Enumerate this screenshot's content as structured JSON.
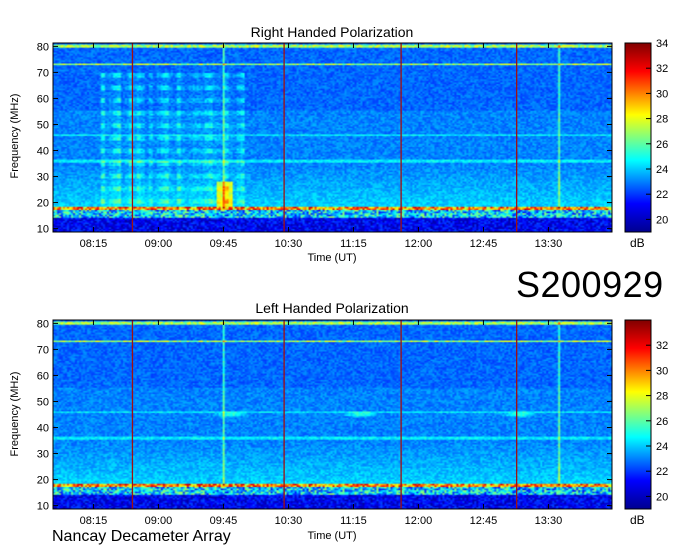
{
  "observation_id": "S200929",
  "instrument": "Nancay Decameter Array",
  "chart_data": [
    {
      "type": "heatmap",
      "title": "Right Handed Polarization",
      "xlabel": "Time (UT)",
      "ylabel": "Frequency (MHz)",
      "x_ticks": [
        "08:15",
        "09:00",
        "09:45",
        "10:30",
        "11:15",
        "12:00",
        "12:45",
        "13:30"
      ],
      "y_ticks": [
        10,
        20,
        30,
        40,
        50,
        60,
        70,
        80
      ],
      "ylim": [
        10,
        80
      ],
      "colorbar": {
        "label": "dB",
        "ticks": [
          20,
          22,
          24,
          26,
          28,
          30,
          32,
          34
        ],
        "range": [
          19,
          34
        ]
      },
      "features": {
        "baseline_db": 22.5,
        "strong_lines_mhz": [
          73,
          80
        ],
        "weak_lines_mhz": [
          36,
          46
        ],
        "low_band_mhz": [
          14,
          18.5
        ],
        "vertical_lines_time": [
          "08:42",
          "10:27",
          "11:48",
          "13:08"
        ],
        "bright_vertical_time": [
          "09:45",
          "13:37"
        ],
        "burst_interval": [
          "08:20",
          "10:00"
        ]
      }
    },
    {
      "type": "heatmap",
      "title": "Left Handed Polarization",
      "xlabel": "Time (UT)",
      "ylabel": "Frequency (MHz)",
      "x_ticks": [
        "08:15",
        "09:00",
        "09:45",
        "10:30",
        "11:15",
        "12:00",
        "12:45",
        "13:30"
      ],
      "y_ticks": [
        10,
        20,
        30,
        40,
        50,
        60,
        70,
        80
      ],
      "ylim": [
        10,
        80
      ],
      "colorbar": {
        "label": "dB",
        "ticks": [
          20,
          22,
          24,
          26,
          28,
          30,
          32
        ],
        "range": [
          19,
          34
        ]
      },
      "features": {
        "baseline_db": 22.5,
        "strong_lines_mhz": [
          73,
          80
        ],
        "weak_lines_mhz": [
          36,
          46
        ],
        "low_band_mhz": [
          14,
          18.5
        ],
        "vertical_lines_time": [
          "08:42",
          "10:27",
          "11:48",
          "13:08"
        ],
        "bright_vertical_time": [
          "09:45",
          "13:37"
        ],
        "patch_times": [
          "09:50",
          "11:20",
          "13:10"
        ],
        "patch_freq_mhz": 45
      }
    }
  ]
}
